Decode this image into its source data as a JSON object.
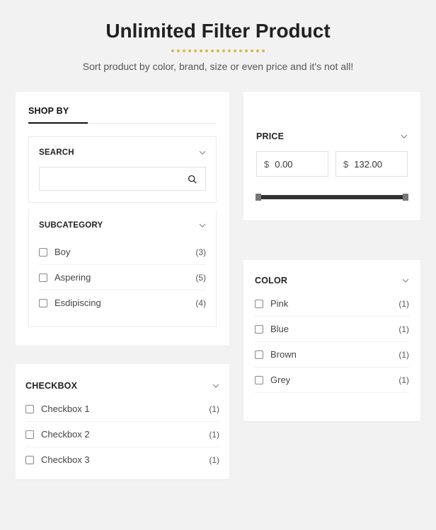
{
  "header": {
    "title": "Unlimited Filter Product",
    "subtitle": "Sort product by color, brand, size or even price and it's not all!"
  },
  "shopby": {
    "title": "SHOP BY",
    "search": {
      "title": "SEARCH",
      "value": ""
    },
    "subcategory": {
      "title": "SUBCATEGORY",
      "items": [
        {
          "label": "Boy",
          "count": "(3)"
        },
        {
          "label": "Aspering",
          "count": "(5)"
        },
        {
          "label": "Esdipiscing",
          "count": "(4)"
        }
      ]
    }
  },
  "checkbox": {
    "title": "CHECKBOX",
    "items": [
      {
        "label": "Checkbox 1",
        "count": "(1)"
      },
      {
        "label": "Checkbox 2",
        "count": "(1)"
      },
      {
        "label": "Checkbox 3",
        "count": "(1)"
      }
    ]
  },
  "price": {
    "title": "PRICE",
    "currency": "$",
    "min": "0.00",
    "max": "132.00"
  },
  "color": {
    "title": "COLOR",
    "items": [
      {
        "label": "Pink",
        "count": "(1)"
      },
      {
        "label": "Blue",
        "count": "(1)"
      },
      {
        "label": "Brown",
        "count": "(1)"
      },
      {
        "label": "Grey",
        "count": "(1)"
      }
    ]
  }
}
